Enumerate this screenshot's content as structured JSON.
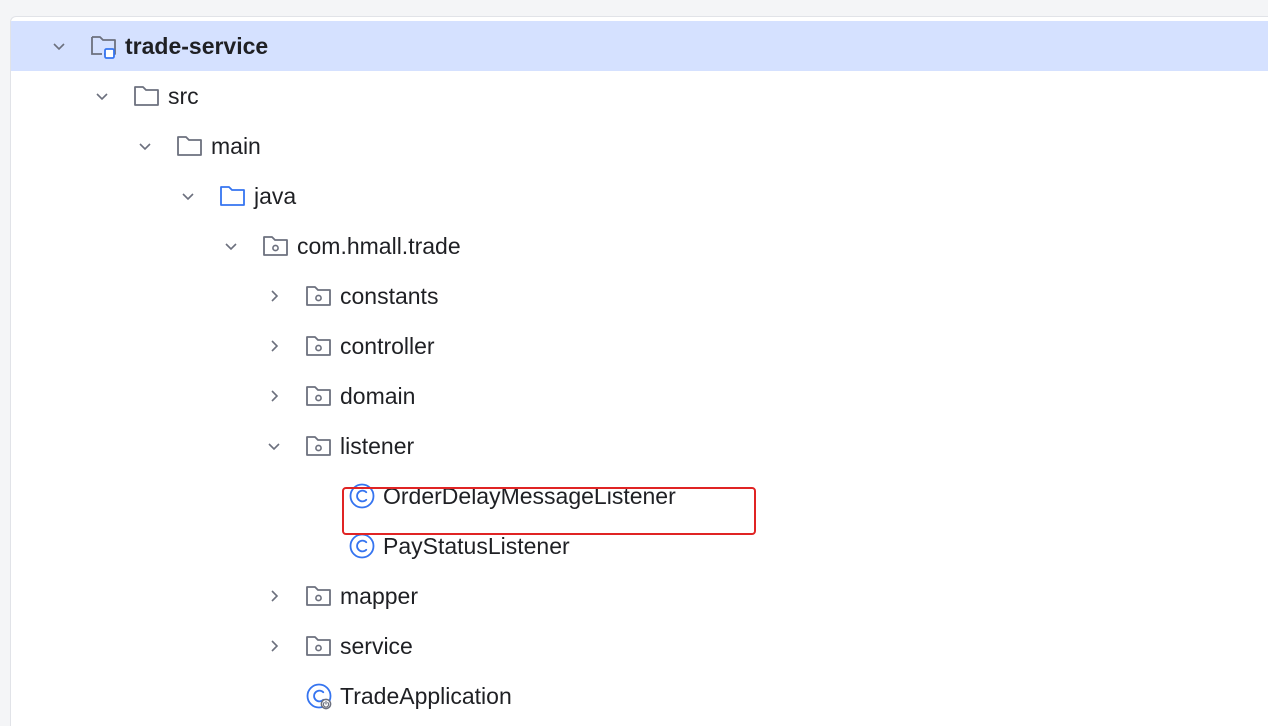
{
  "project_tree": {
    "root": {
      "label": "trade-service",
      "expanded": true,
      "selected": true,
      "icon": "module-folder-icon"
    },
    "src": {
      "label": "src",
      "expanded": true,
      "icon": "folder-icon"
    },
    "main": {
      "label": "main",
      "expanded": true,
      "icon": "folder-icon"
    },
    "java": {
      "label": "java",
      "expanded": true,
      "icon": "source-root-folder-icon"
    },
    "package": {
      "label": "com.hmall.trade",
      "expanded": true,
      "icon": "package-icon"
    },
    "constants": {
      "label": "constants",
      "expanded": false,
      "icon": "package-icon"
    },
    "controller": {
      "label": "controller",
      "expanded": false,
      "icon": "package-icon"
    },
    "domain": {
      "label": "domain",
      "expanded": false,
      "icon": "package-icon"
    },
    "listener": {
      "label": "listener",
      "expanded": true,
      "icon": "package-icon"
    },
    "order_delay_listener": {
      "label": "OrderDelayMessageListener",
      "icon": "java-class-icon",
      "highlighted": true
    },
    "pay_status_listener": {
      "label": "PayStatusListener",
      "icon": "java-class-icon"
    },
    "mapper": {
      "label": "mapper",
      "expanded": false,
      "icon": "package-icon"
    },
    "service": {
      "label": "service",
      "expanded": false,
      "icon": "package-icon"
    },
    "trade_application": {
      "label": "TradeApplication",
      "icon": "spring-boot-class-icon"
    }
  },
  "colors": {
    "selection": "#d5e1ff",
    "highlight_border": "#e02424",
    "class_icon": "#3574f0",
    "folder_icon": "#6c707e",
    "source_root_icon": "#3574f0"
  }
}
